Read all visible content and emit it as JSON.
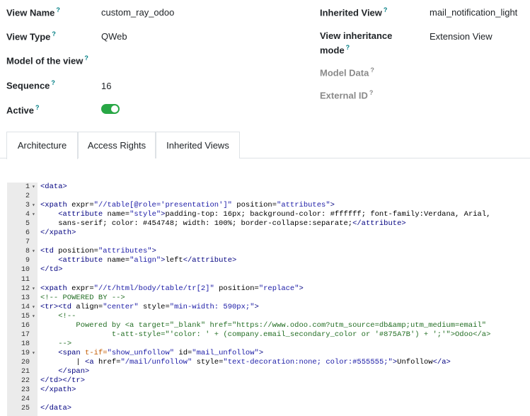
{
  "fields": {
    "view_name": {
      "label": "View Name",
      "value": "custom_ray_odoo"
    },
    "view_type": {
      "label": "View Type",
      "value": "QWeb"
    },
    "model": {
      "label": "Model of the view",
      "value": ""
    },
    "sequence": {
      "label": "Sequence",
      "value": "16"
    },
    "active": {
      "label": "Active",
      "value": true
    },
    "inherited_view": {
      "label": "Inherited View",
      "value": "mail_notification_light"
    },
    "inheritance_mode": {
      "label_line1": "View inheritance",
      "label_line2": "mode",
      "value": "Extension View"
    },
    "model_data": {
      "label": "Model Data"
    },
    "external_id": {
      "label": "External ID"
    },
    "tooltip_mark": "?"
  },
  "tabs": [
    {
      "label": "Architecture",
      "active": true
    },
    {
      "label": "Access Rights",
      "active": false
    },
    {
      "label": "Inherited Views",
      "active": false
    }
  ],
  "code_lines": [
    {
      "n": "1",
      "fold": true,
      "html": "<span class=\"t\">&lt;data&gt;</span>"
    },
    {
      "n": "2",
      "fold": false,
      "html": ""
    },
    {
      "n": "3",
      "fold": true,
      "html": "<span class=\"t\">&lt;xpath</span> <span class=\"a\">expr=</span><span class=\"s\">\"//table[@role='presentation']\"</span> <span class=\"a\">position=</span><span class=\"s\">\"attributes\"</span><span class=\"t\">&gt;</span>"
    },
    {
      "n": "4",
      "fold": true,
      "html": "    <span class=\"t\">&lt;attribute</span> <span class=\"a\">name=</span><span class=\"s\">\"style\"</span><span class=\"t\">&gt;</span>padding-top: 16px; background-color: #ffffff; font-family:Verdana, Arial,"
    },
    {
      "n": "5",
      "fold": false,
      "html": "    sans-serif; color: #454748; width: 100%; border-collapse:separate;<span class=\"t\">&lt;/attribute&gt;</span>"
    },
    {
      "n": "6",
      "fold": false,
      "html": "<span class=\"t\">&lt;/xpath&gt;</span>"
    },
    {
      "n": "7",
      "fold": false,
      "html": ""
    },
    {
      "n": "8",
      "fold": true,
      "html": "<span class=\"t\">&lt;td</span> <span class=\"a\">position=</span><span class=\"s\">\"attributes\"</span><span class=\"t\">&gt;</span>"
    },
    {
      "n": "9",
      "fold": false,
      "html": "    <span class=\"t\">&lt;attribute</span> <span class=\"a\">name=</span><span class=\"s\">\"align\"</span><span class=\"t\">&gt;</span>left<span class=\"t\">&lt;/attribute&gt;</span>"
    },
    {
      "n": "10",
      "fold": false,
      "html": "<span class=\"t\">&lt;/td&gt;</span>"
    },
    {
      "n": "11",
      "fold": false,
      "html": ""
    },
    {
      "n": "12",
      "fold": true,
      "html": "<span class=\"t\">&lt;xpath</span> <span class=\"a\">expr=</span><span class=\"s\">\"//t/html/body/table/tr[2]\"</span> <span class=\"a\">position=</span><span class=\"s\">\"replace\"</span><span class=\"t\">&gt;</span>"
    },
    {
      "n": "13",
      "fold": false,
      "html": "<span class=\"c\">&lt;!-- POWERED BY --&gt;</span>"
    },
    {
      "n": "14",
      "fold": true,
      "html": "<span class=\"t\">&lt;tr&gt;&lt;td</span> <span class=\"a\">align=</span><span class=\"s\">\"center\"</span> <span class=\"a\">style=</span><span class=\"s\">\"min-width: 590px;\"</span><span class=\"t\">&gt;</span>"
    },
    {
      "n": "15",
      "fold": true,
      "html": "    <span class=\"c\">&lt;!--</span>"
    },
    {
      "n": "16",
      "fold": false,
      "html": "<span class=\"c\">        Powered by &lt;a target=\"_blank\" href=\"https://www.odoo.com?utm_source=db&amp;amp;utm_medium=email\"</span>"
    },
    {
      "n": "17",
      "fold": false,
      "html": "<span class=\"c\">                t-att-style=\"'color: ' + (company.email_secondary_color or '#875A7B') + ';'\"&gt;Odoo&lt;/a&gt;</span>"
    },
    {
      "n": "18",
      "fold": false,
      "html": "    <span class=\"c\">--&gt;</span>"
    },
    {
      "n": "19",
      "fold": true,
      "html": "    <span class=\"t\">&lt;span</span> <span class=\"s\" style=\"color:#c35b00\">t-if=</span><span class=\"s\">\"show_unfollow\"</span> <span class=\"a\">id=</span><span class=\"s\">\"mail_unfollow\"</span><span class=\"t\">&gt;</span>"
    },
    {
      "n": "20",
      "fold": false,
      "html": "        | <span class=\"t\">&lt;a</span> <span class=\"a\">href=</span><span class=\"s\">\"/mail/unfollow\"</span> <span class=\"a\">style=</span><span class=\"s\">\"text-decoration:none; color:#555555;\"</span><span class=\"t\">&gt;</span>Unfollow<span class=\"t\">&lt;/a&gt;</span>"
    },
    {
      "n": "21",
      "fold": false,
      "html": "    <span class=\"t\">&lt;/span&gt;</span>"
    },
    {
      "n": "22",
      "fold": false,
      "html": "<span class=\"t\">&lt;/td&gt;&lt;/tr&gt;</span>"
    },
    {
      "n": "23",
      "fold": false,
      "html": "<span class=\"t\">&lt;/xpath&gt;</span>"
    },
    {
      "n": "24",
      "fold": false,
      "html": ""
    },
    {
      "n": "25",
      "fold": false,
      "html": "<span class=\"t\">&lt;/data&gt;</span>"
    }
  ]
}
